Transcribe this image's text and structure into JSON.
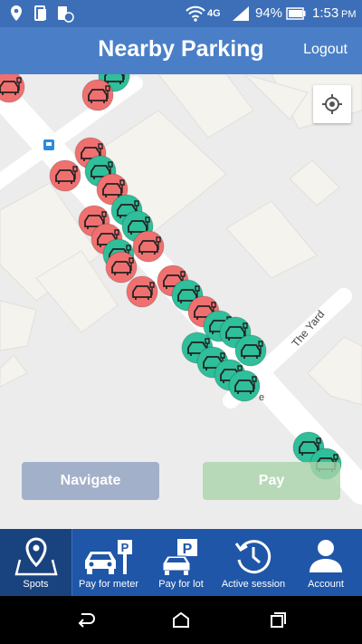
{
  "status_bar": {
    "network": "4G",
    "battery": "94%",
    "time": "1:53",
    "ampm": "PM"
  },
  "app_bar": {
    "title": "Nearby Parking",
    "logout_label": "Logout"
  },
  "map": {
    "street_label": "The Yard",
    "street_fragment": "e",
    "spot_colors": {
      "occupied": "#f07070",
      "available": "#2fbf9a"
    }
  },
  "actions": {
    "navigate_label": "Navigate",
    "pay_label": "Pay"
  },
  "bottom_nav": [
    {
      "label": "Spots",
      "icon": "map-pin-icon",
      "active": true
    },
    {
      "label": "Pay for meter",
      "icon": "car-meter-icon",
      "active": false
    },
    {
      "label": "Pay for lot",
      "icon": "car-parking-icon",
      "active": false
    },
    {
      "label": "Active session",
      "icon": "clock-icon",
      "active": false
    },
    {
      "label": "Account",
      "icon": "account-icon",
      "active": false
    }
  ],
  "system_nav": [
    "back-icon",
    "home-icon",
    "recents-icon"
  ]
}
